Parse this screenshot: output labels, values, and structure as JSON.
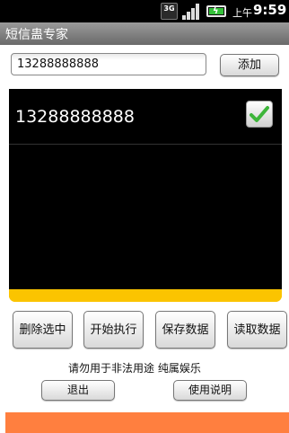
{
  "status_bar": {
    "network_label": "3G",
    "ampm": "上午",
    "time": "9:59",
    "icons": [
      "3g-icon",
      "signal-icon",
      "battery-charging-icon"
    ],
    "battery_color": "#35c13a"
  },
  "title_bar": {
    "title": "短信蛊专家"
  },
  "phone_input": {
    "value": "13288888888"
  },
  "add_button": {
    "label": "添加"
  },
  "number_list": {
    "items": [
      {
        "number": "13288888888",
        "checked": true
      }
    ]
  },
  "progress": {
    "fraction": 1.0,
    "color": "#fbc400"
  },
  "actions": {
    "delete_selected": "删除选中",
    "start_execute": "开始执行",
    "save_data": "保存数据",
    "read_data": "读取数据"
  },
  "disclaimer": "请勿用于非法用途  纯属娱乐",
  "exit_button": {
    "label": "退出"
  },
  "help_button": {
    "label": "使用说明"
  },
  "colors": {
    "accent_bar": "#ff7f3f",
    "check": "#3db53a"
  }
}
